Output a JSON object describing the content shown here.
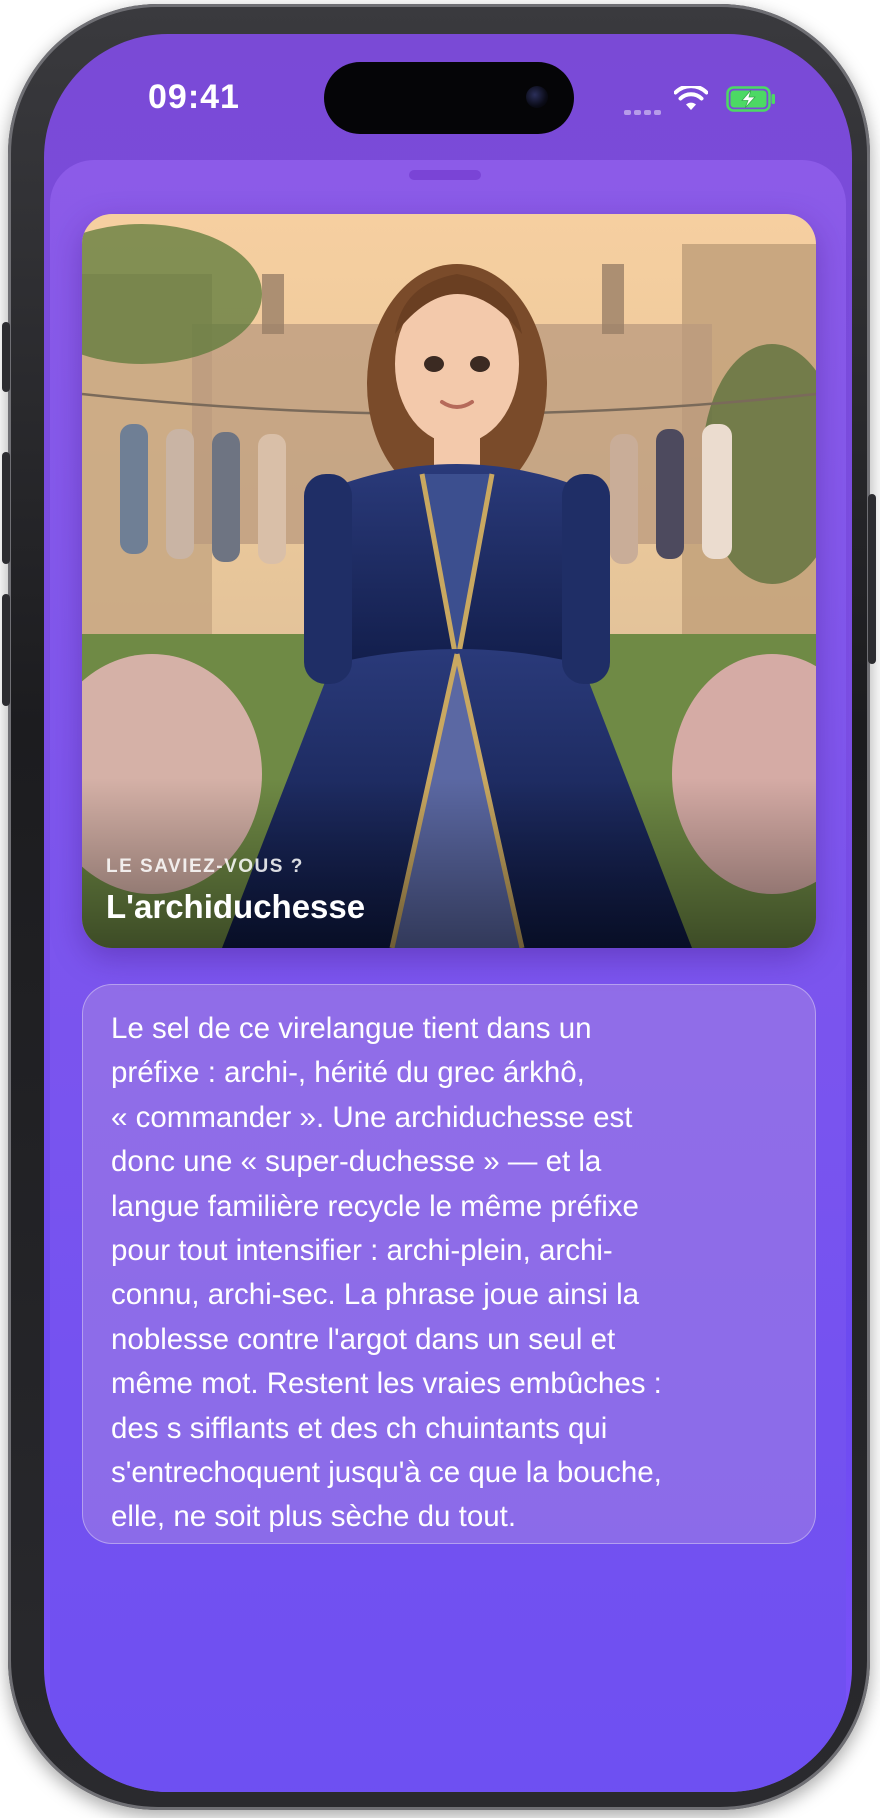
{
  "status_bar": {
    "time": "09:41",
    "icons": [
      "signal-icon",
      "wifi-icon",
      "battery-charging-icon"
    ]
  },
  "card": {
    "image": "illustration-archduchess-with-socks-on-clothesline",
    "eyebrow": "LE SAVIEZ-VOUS ?",
    "title": "L'archiduchesse"
  },
  "explanation": {
    "lines": [
      "Le sel de ce virelangue tient dans un",
      "préfixe : archi-, hérité du grec árkhô,",
      "« commander ». Une archiduchesse est",
      "donc une « super-duchesse » — et la",
      "langue familière recycle le même préfixe",
      "pour tout intensifier : archi-plein, archi-",
      "connu, archi-sec. La phrase joue ainsi la",
      "noblesse contre l'argot dans un seul et",
      "même mot. Restent les vraies embûches :",
      "des s sifflants et des ch chuintants qui",
      "s'entrechoquent jusqu'à ce que la bouche,",
      "elle, ne soit plus sèche du tout."
    ]
  },
  "colors": {
    "background_top": "#7a4ad6",
    "background_bottom": "#7d53fb",
    "text": "#ffffff",
    "battery_charging": "#4cd964"
  }
}
